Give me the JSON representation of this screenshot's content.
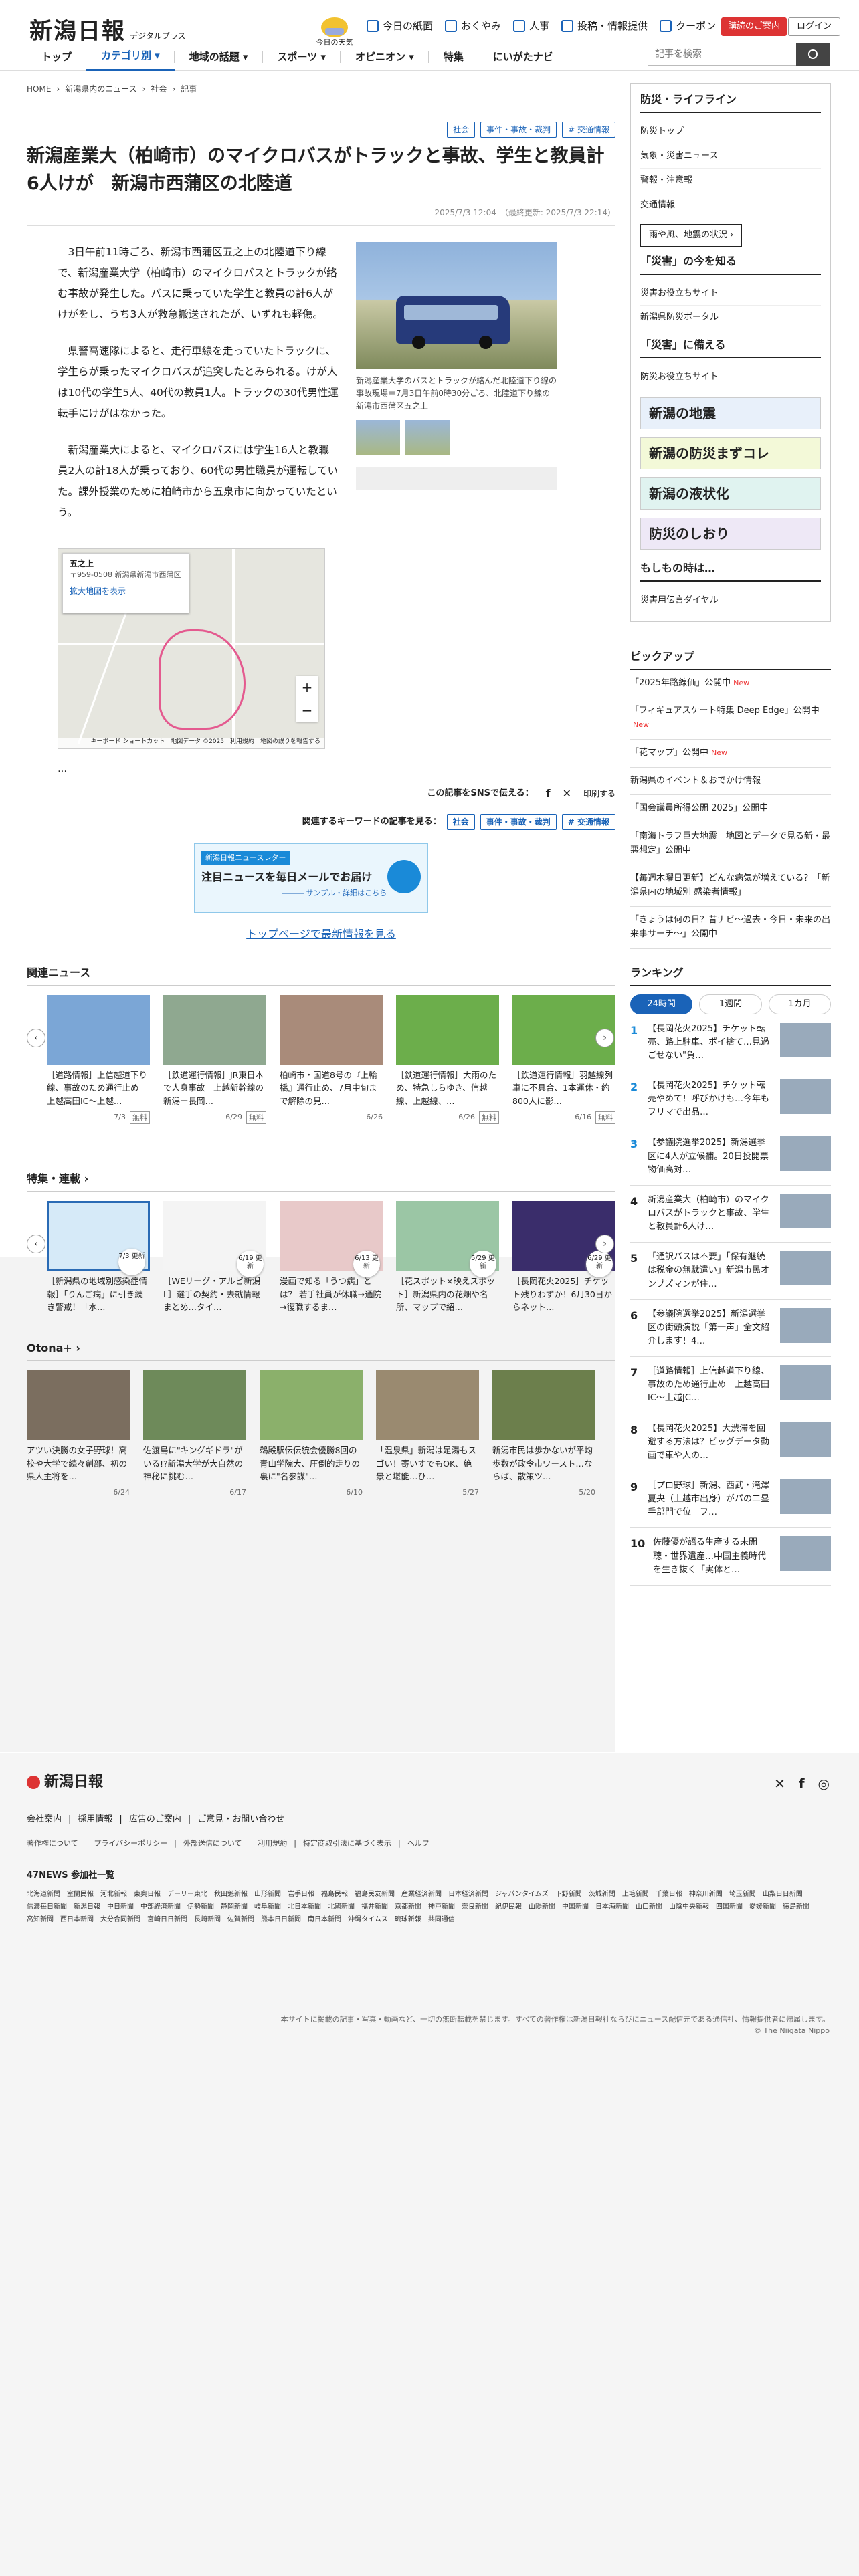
{
  "header": {
    "logo": "新潟日報",
    "logo_sub": "デジタルプラス",
    "today_label": "今日の天気",
    "tools": [
      "今日の紙面",
      "おくやみ",
      "人事",
      "投稿・情報提供",
      "クーポン"
    ],
    "ad_button": "購読のご案内",
    "login": "ログイン",
    "search_placeholder": "記事を検索"
  },
  "nav": [
    "トップ",
    "カテゴリ別 ▾",
    "地域の話題 ▾",
    "スポーツ ▾",
    "オピニオン ▾",
    "特集",
    "にいがたナビ"
  ],
  "breadcrumb": [
    "HOME",
    "新潟県内のニュース",
    "社会",
    "記事"
  ],
  "article": {
    "tags": [
      "社会",
      "事件・事故・裁判",
      "# 交通情報"
    ],
    "title": "新潟産業大（柏崎市）のマイクロバスがトラックと事故、学生と教員計6人けが　新潟市西蒲区の北陸道",
    "date": "2025/7/3 12:04　（最終更新: 2025/7/3 22:14）",
    "paragraphs": [
      "3日午前11時ごろ、新潟市西蒲区五之上の北陸道下り線で、新潟産業大学（柏崎市）のマイクロバスとトラックが絡む事故が発生した。バスに乗っていた学生と教員の計6人がけがをし、うち3人が救急搬送されたが、いずれも軽傷。",
      "県警高速隊によると、走行車線を走っていたトラックに、学生らが乗ったマイクロバスが追突したとみられる。けが人は10代の学生5人、40代の教員1人。トラックの30代男性運転手にけがはなかった。",
      "新潟産業大によると、マイクロバスには学生16人と教職員2人の計18人が乗っており、60代の男性職員が運転していた。課外授業のために柏崎市から五泉市に向かっていたという。"
    ],
    "photo_caption": "新潟産業大学のバスとトラックが絡んだ北陸道下り線の事故現場＝7月3日午前0時30分ごろ、北陸道下り線の新潟市西蒲区五之上",
    "map": {
      "place": "五之上",
      "address": "〒959-0508 新潟県新潟市西蒲区",
      "link": "拡大地図を表示",
      "footer": "キーボード ショートカット　地図データ ©2025　利用規約　地図の誤りを報告する"
    },
    "ellipsis": "…",
    "share_label": "この記事をSNSで伝える：",
    "print": "印刷する",
    "kw_label": "関連するキーワードの記事を見る：",
    "mail": {
      "label": "新潟日報ニュースレター",
      "title": "注目ニュースを毎日メールでお届け",
      "sub": "――― サンプル・詳細はこちら"
    },
    "toplink": "トップページで最新情報を見る"
  },
  "related": {
    "title": "関連ニュース",
    "items": [
      {
        "t": "［道路情報］上信越道下り線、事故のため通行止め　上越高田IC〜上越…",
        "d": "7/3",
        "f": "無料"
      },
      {
        "t": "［鉄道運行情報］JR東日本で人身事故　上越新幹線の新潟ー長岡…",
        "d": "6/29",
        "f": "無料"
      },
      {
        "t": "柏崎市・国道8号の『上輪橋』通行止め、7月中旬まで解除の見…",
        "d": "6/26",
        "f": ""
      },
      {
        "t": "［鉄道運行情報］大雨のため、特急しらゆき、信越線、上越線、…",
        "d": "6/26",
        "f": "無料"
      },
      {
        "t": "［鉄道運行情報］羽越線列車に不具合、1本運休・約800人に影…",
        "d": "6/16",
        "f": "無料"
      }
    ]
  },
  "features": {
    "title": "特集・連載 ›",
    "items": [
      {
        "t": "［新潟県の地域別感染症情報］「りんご病」に引き続き警戒！「水…",
        "d": "7/3 更新"
      },
      {
        "t": "［WEリーグ・アルビ新潟L］選手の契約・去就情報まとめ…タイ…",
        "d": "6/19 更新"
      },
      {
        "t": "漫画で知る「うつ病」とは？ 若手社員が休職→通院→復職するま…",
        "d": "6/13 更新"
      },
      {
        "t": "［花スポット×映えスポット］新潟県内の花畑や名所、マップで紹…",
        "d": "5/29 更新"
      },
      {
        "t": "［長岡花火2025］チケット残りわずか！6月30日からネット…",
        "d": "6/29 更新"
      }
    ]
  },
  "otona": {
    "title": "Otona+ ›",
    "items": [
      {
        "t": "アツい決勝の女子野球！高校や大学で続々創部、初の県人主将を…",
        "d": "6/24"
      },
      {
        "t": "佐渡島に\"キングギドラ\"がいる!?新潟大学が大自然の神秘に挑む…",
        "d": "6/17"
      },
      {
        "t": "鵜殿駅伝伝統会優勝8回の青山学院大、圧倒的走りの裏に\"名参謀\"…",
        "d": "6/10"
      },
      {
        "t": "「温泉県」新潟は足湯もスゴい！寄いすでもOK、絶景と堪能…ひ…",
        "d": "5/27"
      },
      {
        "t": "新潟市民は歩かないが平均歩数が政令市ワースト…ならば、散策ツ…",
        "d": "5/20"
      }
    ]
  },
  "side": {
    "bousai_title": "防災・ライフライン",
    "bousai_links": [
      "防災トップ",
      "気象・災害ニュース",
      "警報・注意報",
      "交通情報"
    ],
    "quake_btn": "雨や風、地震の状況 ›",
    "now_title": "「災害」の今を知る",
    "now_links": [
      "災害お役立ちサイト",
      "新潟県防災ポータル"
    ],
    "prep_title": "「災害」に備える",
    "prep_links": [
      "防災お役立ちサイト"
    ],
    "banners": [
      "新潟の地震",
      "新潟の防災まずコレ",
      "新潟の液状化",
      "防災のしおり"
    ],
    "moshi_title": "もしもの時は…",
    "moshi_links": [
      "災害用伝言ダイヤル"
    ],
    "pick_title": "ピックアップ",
    "picks": [
      {
        "t": "「2025年路線価」公開中",
        "n": "New"
      },
      {
        "t": "「フィギュアスケート特集 Deep Edge」公開中",
        "n": "New"
      },
      {
        "t": "「花マップ」公開中",
        "n": "New"
      },
      {
        "t": "新潟県のイベント＆おでかけ情報",
        "n": ""
      },
      {
        "t": "「国会議員所得公開 2025」公開中",
        "n": ""
      },
      {
        "t": "「南海トラフ巨大地震　地図とデータで見る新・最悪想定」公開中",
        "n": ""
      },
      {
        "t": "【毎週木曜日更新】どんな病気が増えている？「新潟県内の地域別 感染者情報」",
        "n": ""
      },
      {
        "t": "「きょうは何の日？昔ナビ〜過去・今日・未来の出来事サーチ〜」公開中",
        "n": ""
      }
    ],
    "rank_title": "ランキング",
    "rank_tabs": [
      "24時間",
      "1週間",
      "1カ月"
    ],
    "ranks": [
      {
        "n": "1",
        "t": "【長岡花火2025】チケット転売、路上駐車、ポイ捨て…見過ごせない\"負…"
      },
      {
        "n": "2",
        "t": "【長岡花火2025】チケット転売やめて！呼びかけも…今年もフリマで出品…"
      },
      {
        "n": "3",
        "t": "【参議院選挙2025】新潟選挙区に4人が立候補。20日投開票　物価高対…"
      },
      {
        "n": "4",
        "t": "新潟産業大（柏崎市）のマイクロバスがトラックと事故、学生と教員計6人け…"
      },
      {
        "n": "5",
        "t": "「通訳バスは不要」「保有継続は税金の無駄遣い」新潟市民オンブズマンが住…"
      },
      {
        "n": "6",
        "t": "【参議院選挙2025】新潟選挙区の街頭演説「第一声」全文紹介します！4…"
      },
      {
        "n": "7",
        "t": "［道路情報］上信越道下り線、事故のため通行止め　上越高田IC〜上越JC…"
      },
      {
        "n": "8",
        "t": "【長岡花火2025】大渋滞を回避する方法は？ビッグデータ動画で車や人の…"
      },
      {
        "n": "9",
        "t": "［プロ野球］新潟、西武・滝澤夏央（上越市出身）がパの二塁手部門で位　フ…"
      },
      {
        "n": "10",
        "t": "佐藤優が語る生産する未開聴・世界遺産…中国主義時代を生き抜く「実体と…"
      }
    ]
  },
  "footer": {
    "logo": "新潟日報",
    "links1": [
      "会社案内",
      "採用情報",
      "広告のご案内",
      "ご意見・お問い合わせ"
    ],
    "links2": [
      "著作権について",
      "プライバシーポリシー",
      "外部送信について",
      "利用規約",
      "特定商取引法に基づく表示",
      "ヘルプ"
    ],
    "n47": "47NEWS 参加社一覧",
    "papers": [
      "北海道新聞",
      "室蘭民報",
      "河北新報",
      "東奥日報",
      "デーリー東北",
      "秋田魁新報",
      "山形新聞",
      "岩手日報",
      "福島民報",
      "福島民友新聞",
      "産業経済新聞",
      "日本経済新聞",
      "ジャパンタイムズ",
      "下野新聞",
      "茨城新聞",
      "上毛新聞",
      "千葉日報",
      "神奈川新聞",
      "埼玉新聞",
      "山梨日日新聞",
      "信濃毎日新聞",
      "新潟日報",
      "中日新聞",
      "中部経済新聞",
      "伊勢新聞",
      "静岡新聞",
      "岐阜新聞",
      "北日本新聞",
      "北國新聞",
      "福井新聞",
      "京都新聞",
      "神戸新聞",
      "奈良新聞",
      "紀伊民報",
      "山陽新聞",
      "中国新聞",
      "日本海新聞",
      "山口新聞",
      "山陰中央新報",
      "四国新聞",
      "愛媛新聞",
      "徳島新聞",
      "高知新聞",
      "西日本新聞",
      "大分合同新聞",
      "宮崎日日新聞",
      "長崎新聞",
      "佐賀新聞",
      "熊本日日新聞",
      "南日本新聞",
      "沖縄タイムス",
      "琉球新報",
      "共同通信"
    ],
    "notice": "本サイトに掲載の記事・写真・動画など、一切の無断転載を禁じます。すべての著作権は新潟日報社ならびにニュース配信元である通信社、情報提供者に帰属します。",
    "copyright": "© The Niigata Nippo"
  }
}
